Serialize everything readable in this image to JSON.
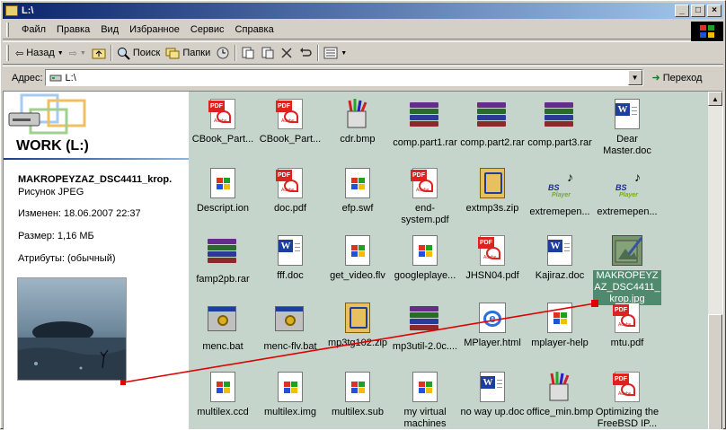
{
  "window": {
    "title": "L:\\"
  },
  "menu": {
    "items": [
      "Файл",
      "Правка",
      "Вид",
      "Избранное",
      "Сервис",
      "Справка"
    ]
  },
  "toolbar": {
    "back": "Назад",
    "search": "Поиск",
    "folders": "Папки"
  },
  "address": {
    "label": "Адрес:",
    "value": "L:\\",
    "go": "Переход"
  },
  "drive": {
    "title": "WORK (L:)"
  },
  "details": {
    "name": "MAKROPEYZAZ_DSC4411_krop.",
    "type": "Рисунок JPEG",
    "modified": "Изменен: 18.06.2007 22:37",
    "size": "Размер: 1,16 МБ",
    "attributes": "Атрибуты: (обычный)"
  },
  "files": [
    {
      "label": "CBook_Part...",
      "icon": "pdf-icon"
    },
    {
      "label": "CBook_Part...",
      "icon": "pdf-icon"
    },
    {
      "label": "cdr.bmp",
      "icon": "bmp-icon"
    },
    {
      "label": "comp.part1.rar",
      "icon": "rar-icon"
    },
    {
      "label": "comp.part2.rar",
      "icon": "rar-icon"
    },
    {
      "label": "comp.part3.rar",
      "icon": "rar-icon"
    },
    {
      "label": "Dear Master.doc",
      "icon": "doc-icon"
    },
    {
      "label": "Descript.ion",
      "icon": "file-icon"
    },
    {
      "label": "doc.pdf",
      "icon": "pdf-icon"
    },
    {
      "label": "efp.swf",
      "icon": "file-icon"
    },
    {
      "label": "end-system.pdf",
      "icon": "pdf-icon"
    },
    {
      "label": "extmp3s.zip",
      "icon": "zip-icon"
    },
    {
      "label": "extremepen...",
      "icon": "bsplayer-icon"
    },
    {
      "label": "extremepen...",
      "icon": "bsplayer-icon"
    },
    {
      "label": "famp2pb.rar",
      "icon": "rar-icon"
    },
    {
      "label": "fff.doc",
      "icon": "doc-icon"
    },
    {
      "label": "get_video.flv",
      "icon": "file-icon"
    },
    {
      "label": "googleplaye...",
      "icon": "file-icon"
    },
    {
      "label": "JHSN04.pdf",
      "icon": "pdf-icon"
    },
    {
      "label": "Kajiraz.doc",
      "icon": "doc-icon"
    },
    {
      "label": "MAKROPEYZAZ_DSC4411_krop.jpg",
      "icon": "jpg-icon",
      "selected": true
    },
    {
      "label": "menc.bat",
      "icon": "bat-icon"
    },
    {
      "label": "menc-flv.bat",
      "icon": "bat-icon"
    },
    {
      "label": "mp3tg102.zip",
      "icon": "zip-icon"
    },
    {
      "label": "mp3util-2.0c....",
      "icon": "rar-icon"
    },
    {
      "label": "MPlayer.html",
      "icon": "html-icon"
    },
    {
      "label": "mplayer-help",
      "icon": "file-icon"
    },
    {
      "label": "mtu.pdf",
      "icon": "pdf-icon"
    },
    {
      "label": "multilex.ccd",
      "icon": "file-icon"
    },
    {
      "label": "multilex.img",
      "icon": "file-icon"
    },
    {
      "label": "multilex.sub",
      "icon": "file-icon"
    },
    {
      "label": "my virtual machines",
      "icon": "file-icon"
    },
    {
      "label": "no way up.doc",
      "icon": "doc-icon"
    },
    {
      "label": "office_min.bmp",
      "icon": "bmp-icon"
    },
    {
      "label": "Optimizing the FreeBSD IP...",
      "icon": "pdf-icon"
    }
  ],
  "colors": {
    "titlebar": "#0a246a",
    "content_bg": "#c5d5cb",
    "selection": "#4f8a6e",
    "pointer_line": "#e00000"
  }
}
